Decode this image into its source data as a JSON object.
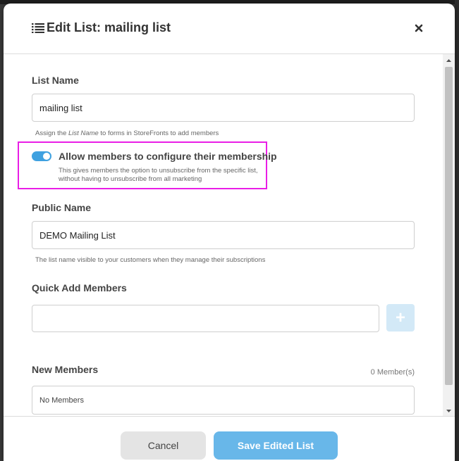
{
  "modal": {
    "title": "Edit List: mailing list",
    "icons": {
      "title": "list-icon",
      "close": "close-icon"
    }
  },
  "list_name": {
    "label": "List Name",
    "value": "mailing list",
    "hint_prefix": "Assign the ",
    "hint_emphasis": "List Name",
    "hint_suffix": " to forms in StoreFronts to add members"
  },
  "membership_toggle": {
    "enabled": true,
    "title": "Allow members to configure their membership",
    "description": "This gives members the option to unsubscribe from the specific list, without having to unsubscribe from all marketing",
    "color": "#3fa1e0",
    "highlight_color": "#e91ee6"
  },
  "public_name": {
    "label": "Public Name",
    "value": "DEMO Mailing List",
    "hint": "The list name visible to your customers when they manage their subscriptions"
  },
  "quick_add": {
    "label": "Quick Add Members",
    "value": "",
    "add_icon": "plus-icon",
    "add_glyph": "+"
  },
  "new_members": {
    "label": "New Members",
    "count": "0 Member(s)",
    "empty_text": "No Members"
  },
  "footer": {
    "cancel_label": "Cancel",
    "save_label": "Save Edited List",
    "save_color": "#68b7e9"
  }
}
